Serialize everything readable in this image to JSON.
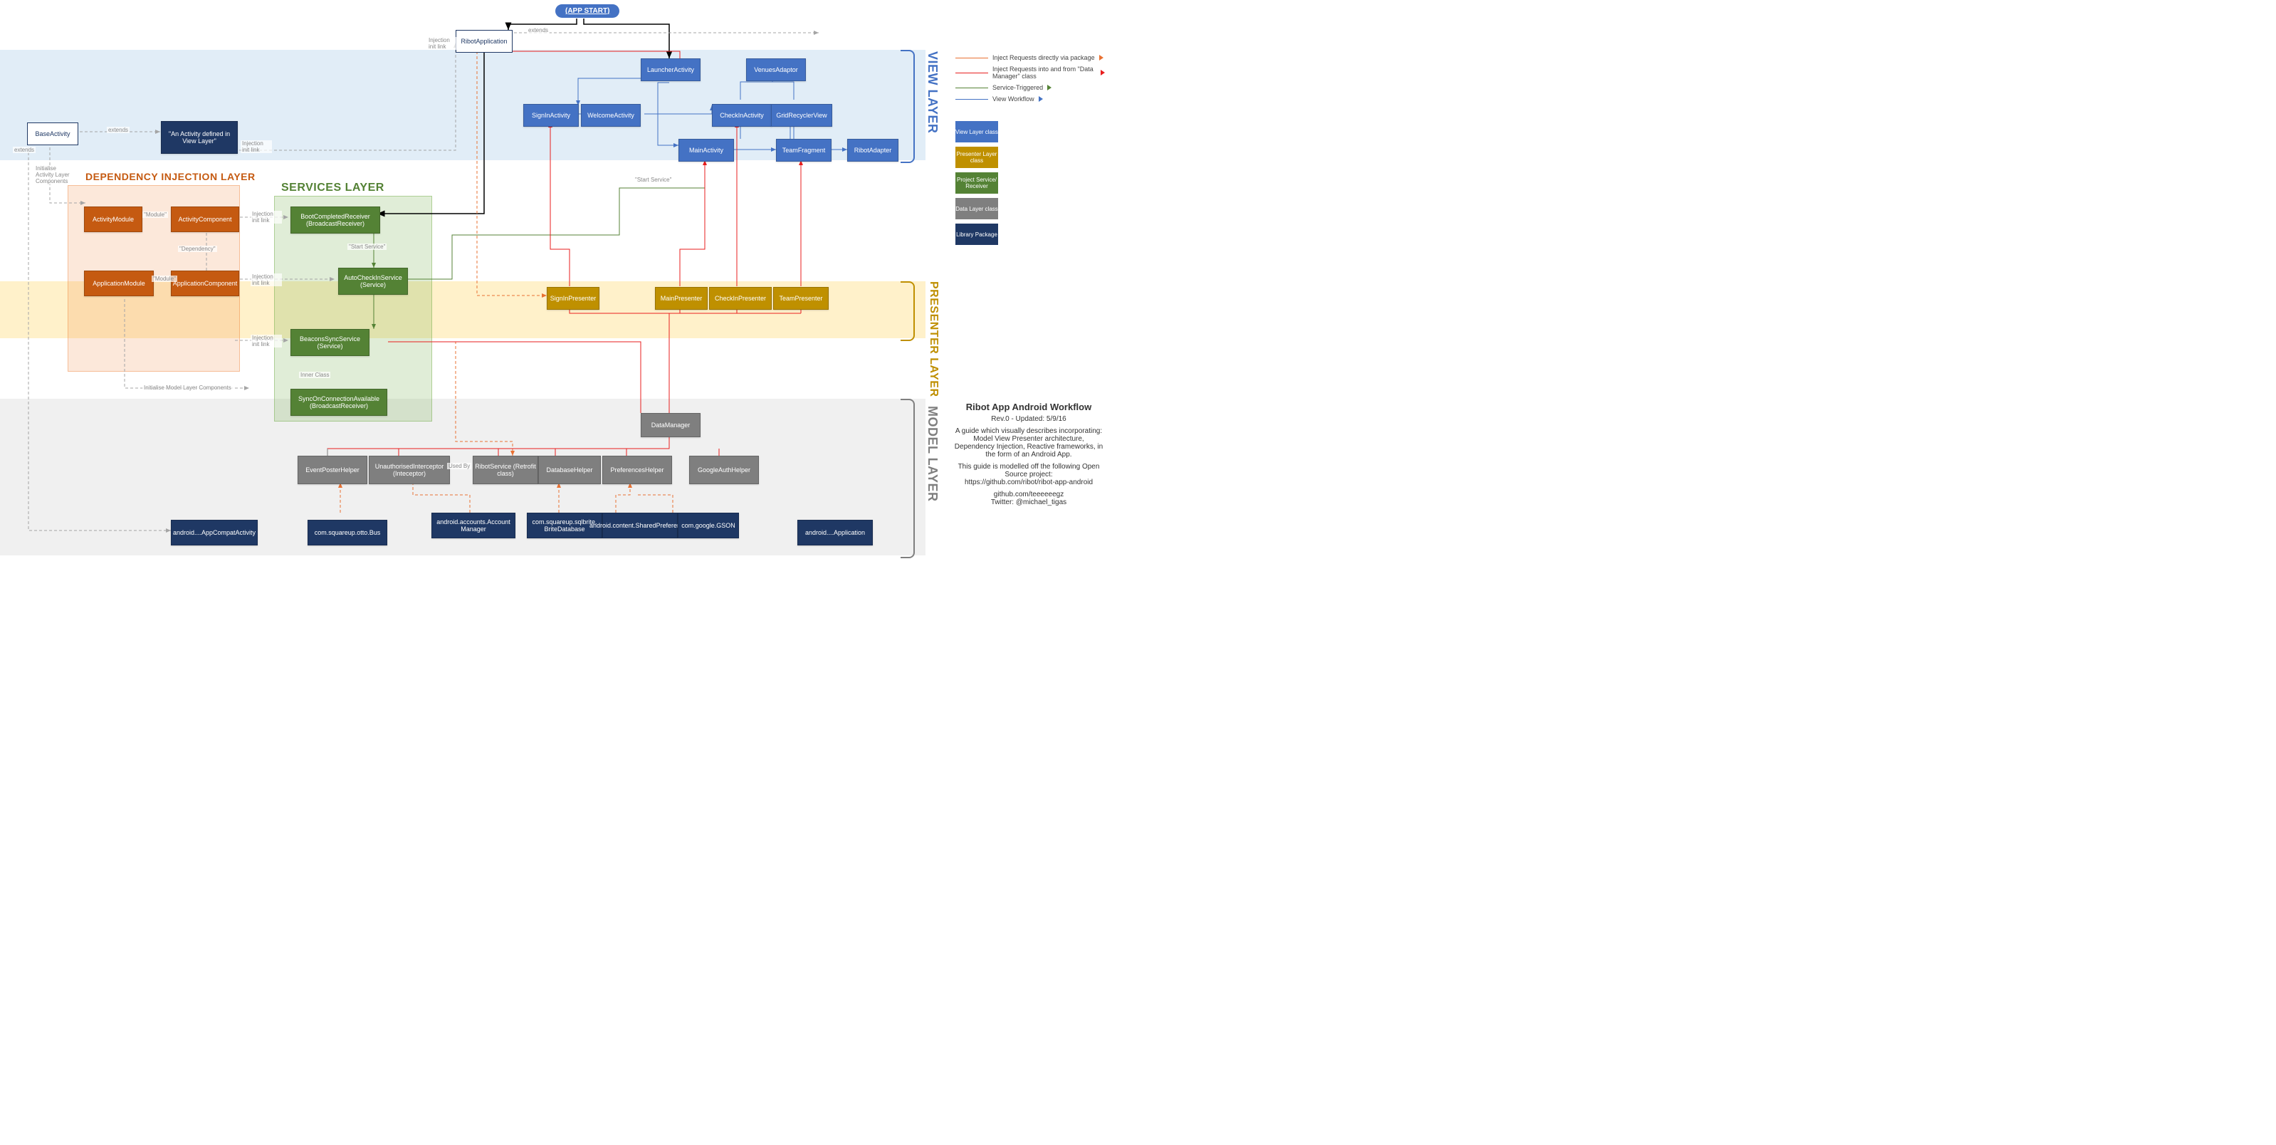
{
  "appStart": "(APP START)",
  "layers": {
    "view": "VIEW LAYER",
    "presenter": "PRESENTER LAYER",
    "model": "MODEL LAYER",
    "di": "DEPENDENCY INJECTION LAYER",
    "services": "SERVICES LAYER"
  },
  "nodes": {
    "ribotApplication": "RibotApplication",
    "baseActivity": "BaseActivity",
    "activityDefined": "\"An Activity defined in View Layer\"",
    "launcherActivity": "LauncherActivity",
    "venuesAdaptor": "VenuesAdaptor",
    "signInActivity": "SignInActivity",
    "welcomeActivity": "WelcomeActivity",
    "checkInActivity": "CheckInActivity",
    "gridRecyclerView": "GridRecyclerView",
    "mainActivity": "MainActivity",
    "teamFragment": "TeamFragment",
    "ribotAdapter": "RibotAdapter",
    "signInPresenter": "SignInPresenter",
    "mainPresenter": "MainPresenter",
    "checkInPresenter": "CheckInPresenter",
    "teamPresenter": "TeamPresenter",
    "activityModule": "ActivityModule",
    "activityComponent": "ActivityComponent",
    "applicationModule": "ApplicationModule",
    "applicationComponent": "ApplicationComponent",
    "bootCompletedReceiver": "BootCompletedReceiver (BroadcastReceiver)",
    "autoCheckInService": "AutoCheckInService (Service)",
    "beaconsSyncService": "BeaconsSyncService (Service)",
    "syncOnConnectionAvailable": "SyncOnConnectionAvailable (BroadcastReceiver)",
    "dataManager": "DataManager",
    "eventPosterHelper": "EventPosterHelper",
    "unauthorisedInterceptor": "UnauthorisedInterceptor (Inteceptor)",
    "ribotService": "RibotService (Retrofit class)",
    "databaseHelper": "DatabaseHelper",
    "preferencesHelper": "PreferencesHelper",
    "googleAuthHelper": "GoogleAuthHelper",
    "appCompatActivity": "android....AppCompatActivity",
    "ottoBus": "com.squareup.otto.Bus",
    "accountManager": "android.accounts.Account Manager",
    "briteDatabase": "com.squareup.sqlbrite. BriteDatabase",
    "sharedPreferences": "android.content.SharedPreferences",
    "gson": "com.google.GSON",
    "androidApplication": "android....Application"
  },
  "edgeLabels": {
    "extends": "extends",
    "module": "\"Module\"",
    "dependency": "\"Dependency\"",
    "injectionInitLink": "Injection init link",
    "startService": "\"Start Service\"",
    "initActivityComponents": "Initialise Activity Layer Components",
    "initModelComponents": "Initialise Model Layer Components",
    "usedBy": "Used By",
    "innerClass": "Inner Class"
  },
  "legend": {
    "orange": "Inject Requests directly via package",
    "red": "Inject Requests into and from \"Data Manager\" class",
    "green": "Service-Triggered",
    "blue": "View Workflow",
    "swViewClass": "View Layer class",
    "swPresenterClass": "Presenter Layer class",
    "swService": "Project Service/ Receiver",
    "swDataClass": "Data Layer class",
    "swLibrary": "Library Package"
  },
  "info": {
    "title": "Ribot App Android Workflow",
    "rev": "Rev.0 - Updated: 5/9/16",
    "desc": "A guide which visually describes incorporating: Model View Presenter architecture, Dependency Injection, Reactive frameworks, in the form of an Android App.",
    "projLine": "This guide is modelled off the following Open Source project:",
    "projUrl": "https://github.com/ribot/ribot-app-android",
    "gh": "github.com/teeeeeegz",
    "tw": "Twitter: @michael_tigas"
  },
  "colors": {
    "orange": "#E97132",
    "red": "#E81E1E",
    "green": "#548235",
    "blue": "#4472C4",
    "grey": "#A5A5A5",
    "dash": "#A5A5A5"
  }
}
